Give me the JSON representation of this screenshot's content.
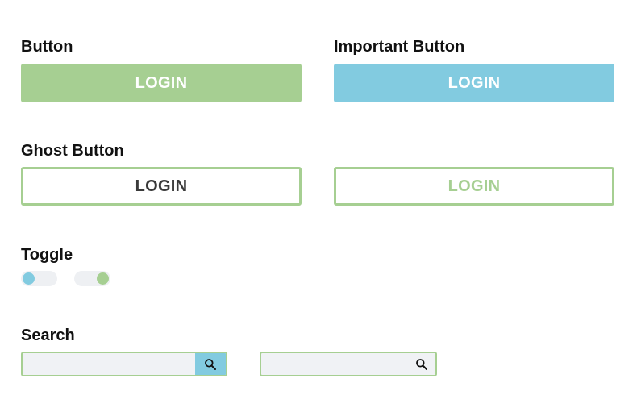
{
  "sections": {
    "button": {
      "label": "Button",
      "primary_label": "LOGIN"
    },
    "important_button": {
      "label": "Important Button",
      "primary_label": "LOGIN"
    },
    "ghost_button": {
      "label": "Ghost Button",
      "dark_label": "LOGIN",
      "green_label": "LOGIN"
    },
    "toggle": {
      "label": "Toggle",
      "toggles": [
        {
          "state": "off",
          "knob_color": "#82cbe0"
        },
        {
          "state": "on",
          "knob_color": "#a6cf92"
        }
      ]
    },
    "search": {
      "label": "Search",
      "inputs": [
        {
          "value": "",
          "placeholder": "",
          "icon": "search-icon"
        },
        {
          "value": "",
          "placeholder": "",
          "icon": "search-icon"
        }
      ]
    }
  },
  "colors": {
    "green": "#a6cf92",
    "blue": "#82cbe0",
    "track": "#eef0f3",
    "input_bg": "#f0f2f5",
    "dark_text": "#3a3a3a"
  }
}
